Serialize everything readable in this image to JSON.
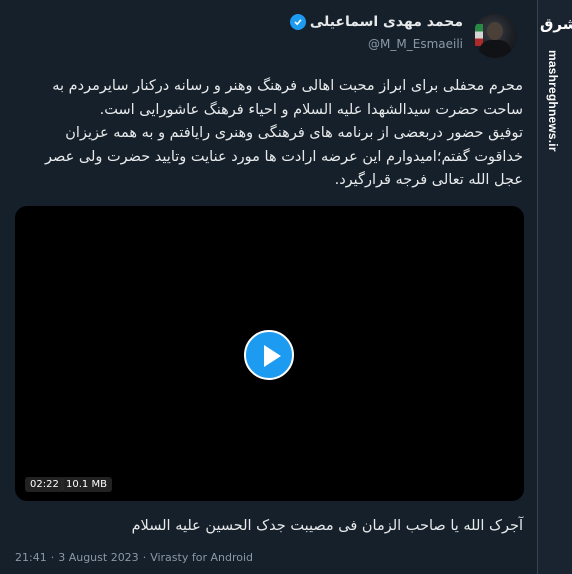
{
  "brand": {
    "logo_text": "مشرق",
    "site": "mashreghnews.ir"
  },
  "user": {
    "name": "محمد مهدی اسماعیلی",
    "handle": "@M_M_Esmaeili"
  },
  "tweet": {
    "lines": [
      "محرم محفلی برای ابراز محبت اهالی فرهنگ وهنر و رسانه درکنار سایرمردم به",
      "ساحت حضرت سیدالشهدا علیه السلام و احیاء فرهنگ عاشورایی است.",
      "توفیق حضور دربعضی از برنامه های فرهنگی وهنری رایافتم و به همه عزیزان",
      "خداقوت گفتم؛امیدوارم این عرضه ارادت ها مورد عنایت وتایید حضرت ولی عصر",
      "عجل الله تعالی فرجه قرارگیرد."
    ],
    "caption": "آجرک الله یا صاحب الزمان فی مصیبت جدک الحسین علیه السلام"
  },
  "video": {
    "duration": "02:22",
    "size": "10.1 MB"
  },
  "meta": {
    "time": "21:41",
    "date": "3 August 2023",
    "source": "Virasty for Android"
  },
  "colors": {
    "background": "#15202b",
    "accent": "#1d9bf0",
    "muted": "#8b98a5"
  }
}
